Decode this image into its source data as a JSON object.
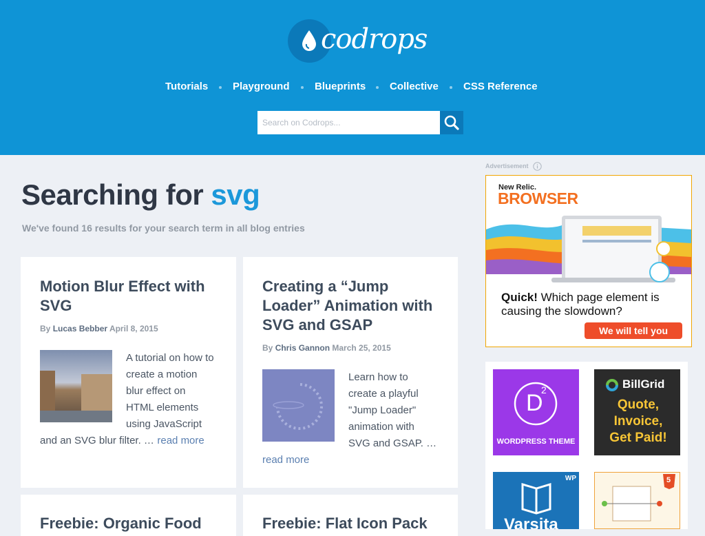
{
  "header": {
    "logo_text": "codrops",
    "nav": [
      "Tutorials",
      "Playground",
      "Blueprints",
      "Collective",
      "CSS Reference"
    ],
    "search_placeholder": "Search on Codrops..."
  },
  "main": {
    "heading_prefix": "Searching for",
    "heading_term": "svg",
    "results_text": "We've found 16 results for your search term in all blog entries",
    "articles": [
      {
        "title": "Motion Blur Effect with SVG",
        "by": "By",
        "author": "Lucas Bebber",
        "date": "April 8, 2015",
        "excerpt": "A tutorial on how to create a motion blur effect on HTML elements using JavaScript and an SVG blur filter. …",
        "read_more": "read more"
      },
      {
        "title": "Creating a “Jump Loader” Animation with SVG and GSAP",
        "by": "By",
        "author": "Chris Gannon",
        "date": "March 25, 2015",
        "excerpt": "Learn how to create a playful \"Jump Loader\" animation with SVG and GSAP. …",
        "read_more": "read more"
      },
      {
        "title": "Freebie: Organic Food"
      },
      {
        "title": "Freebie: Flat Icon Pack"
      }
    ]
  },
  "sidebar": {
    "ad_label": "Advertisement",
    "ad": {
      "brand_small": "New Relic.",
      "brand": "BROWSER",
      "headline_bold": "Quick!",
      "headline_rest": " Which page element is causing the slowdown?",
      "cta": "We will tell you"
    },
    "tiles": [
      {
        "label": "WORDPRESS THEME",
        "glyph": "D",
        "sup": "2",
        "color": "#9b38e8"
      },
      {
        "brand": "BillGrid",
        "text": "Quote, Invoice, Get Paid!",
        "color": "#2b2b2b"
      },
      {
        "badge": "WP",
        "text": "Varsita",
        "color": "#1b73b8"
      },
      {
        "badge": "5",
        "color": "#fdf6e6"
      }
    ]
  }
}
